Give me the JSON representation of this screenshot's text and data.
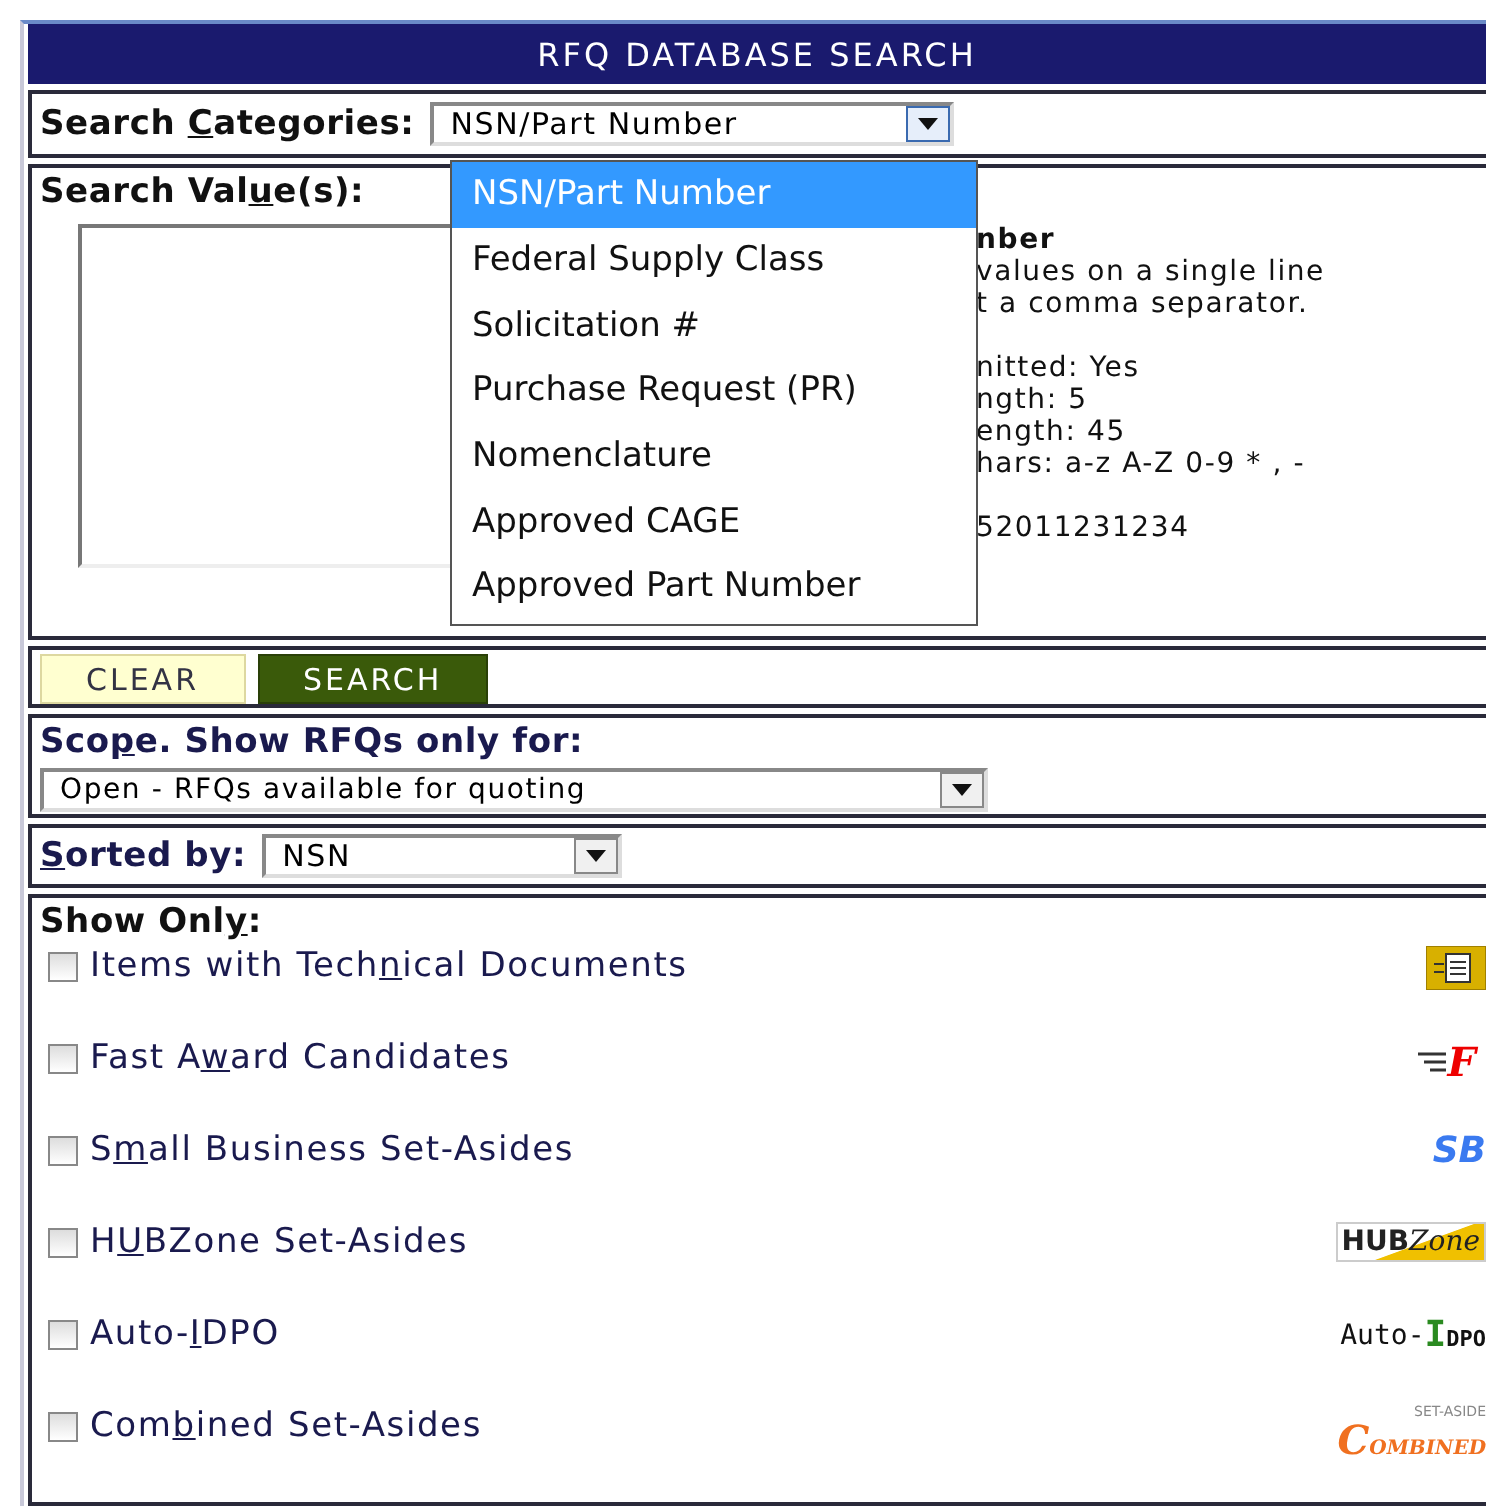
{
  "header": {
    "title": "RFQ DATABASE SEARCH"
  },
  "category": {
    "label": {
      "before": "Search ",
      "key": "C",
      "after": "ategories:"
    },
    "value": "NSN/Part Number",
    "expanded": true,
    "options": [
      {
        "label": "NSN/Part Number",
        "selected": true
      },
      {
        "label": "Federal Supply Class",
        "selected": false
      },
      {
        "label": "Solicitation #",
        "selected": false
      },
      {
        "label": "Purchase Request (PR)",
        "selected": false
      },
      {
        "label": "Nomenclature",
        "selected": false
      },
      {
        "label": "Approved CAGE",
        "selected": false
      },
      {
        "label": "Approved Part Number",
        "selected": false
      }
    ]
  },
  "values": {
    "label": {
      "before": "Search Val",
      "key": "u",
      "after": "e(s):"
    },
    "help": {
      "title": "nber",
      "lines": [
        "values on a single line",
        "t a comma separator."
      ],
      "rules": [
        "nitted: Yes",
        "ngth: 5",
        "ength: 45",
        "hars: a-z A-Z 0-9 * , -"
      ],
      "example": "52011231234"
    }
  },
  "buttons": [
    {
      "label": "CLEAR",
      "kind": "secondary"
    },
    {
      "label": "SEARCH",
      "kind": "primary"
    }
  ],
  "scope": {
    "label": {
      "before": "Sco",
      "key": "p",
      "after": "e. Show RFQs only for:"
    },
    "value": "Open - RFQs available for quoting"
  },
  "sort": {
    "label": {
      "key": "S",
      "after": "orted by:"
    },
    "value": "NSN"
  },
  "show_only": {
    "label": {
      "before": "Show Onl",
      "key": "y",
      "after": ":"
    },
    "options": [
      {
        "label": {
          "before": "Items with Tech",
          "key": "n",
          "after": "ical Documents"
        },
        "checked": false,
        "badge": {
          "kind": "docs"
        }
      },
      {
        "label": {
          "before": "Fast A",
          "key": "w",
          "after": "ard Candidates"
        },
        "checked": false,
        "badge": {
          "kind": "fast",
          "texts": [
            "F"
          ]
        }
      },
      {
        "label": {
          "before": "S",
          "key": "m",
          "after": "all Business Set-Asides"
        },
        "checked": false,
        "badge": {
          "kind": "sb",
          "texts": [
            "SB"
          ]
        }
      },
      {
        "label": {
          "before": "H",
          "key": "U",
          "after": "BZone Set-Asides"
        },
        "checked": false,
        "badge": {
          "kind": "hubzone",
          "texts": [
            "HUB",
            "Zone"
          ]
        }
      },
      {
        "label": {
          "before": "Auto-",
          "key": "I",
          "after": "DPO"
        },
        "checked": false,
        "badge": {
          "kind": "idpo",
          "texts": [
            "Auto-",
            "IDPO"
          ]
        }
      },
      {
        "label": {
          "before": "Com",
          "key": "b",
          "after": "ined Set-Asides"
        },
        "checked": false,
        "badge": {
          "kind": "combined",
          "texts": [
            "SET-ASIDE",
            "COMBINED"
          ]
        }
      }
    ]
  }
}
